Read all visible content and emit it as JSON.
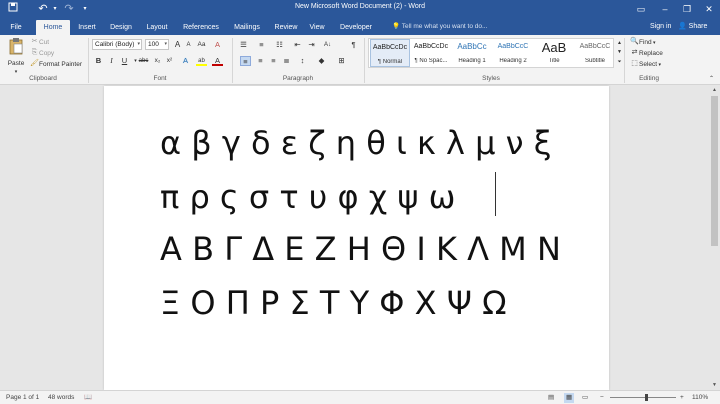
{
  "titlebar": {
    "title": "New Microsoft Word Document (2) - Word",
    "window_buttons": [
      "–",
      "❐",
      "✕"
    ]
  },
  "tabs": [
    "File",
    "Home",
    "Insert",
    "Design",
    "Layout",
    "References",
    "Mailings",
    "Review",
    "View",
    "Developer"
  ],
  "active_tab": "Home",
  "tell_me": "Tell me what you want to do...",
  "sign_in": "Sign in",
  "share": "Share",
  "clipboard": {
    "paste": "Paste",
    "cut": "Cut",
    "copy": "Copy",
    "format_painter": "Format Painter",
    "label": "Clipboard"
  },
  "font": {
    "family": "Calibri (Body)",
    "size": "100",
    "label": "Font",
    "bold": "B",
    "italic": "I",
    "underline": "U",
    "strike": "abc",
    "subscript": "x₂",
    "superscript": "x²",
    "grow": "A",
    "shrink": "A",
    "case": "Aa",
    "clear": "A",
    "effects": "A",
    "highlight": "ab",
    "color": "A"
  },
  "paragraph": {
    "label": "Paragraph",
    "sort": "A↓",
    "show_marks": "¶"
  },
  "styles": {
    "label": "Styles",
    "items": [
      {
        "preview": "AaBbCcDc",
        "name": "¶ Normal"
      },
      {
        "preview": "AaBbCcDc",
        "name": "¶ No Spac..."
      },
      {
        "preview": "AaBbCc",
        "name": "Heading 1"
      },
      {
        "preview": "AaBbCcC",
        "name": "Heading 2"
      },
      {
        "preview": "AaB",
        "name": "Title"
      },
      {
        "preview": "AaBbCcC",
        "name": "Subtitle"
      }
    ]
  },
  "editing": {
    "label": "Editing",
    "find": "Find",
    "replace": "Replace",
    "select": "Select"
  },
  "document": {
    "lines": [
      "α β γ δ ε ζ η θ ι κ λ μ ν ξ",
      "π ρ ς σ τ υ φ χ ψ ω",
      "Α Β Γ Δ Ε Ζ Η Θ Ι Κ Λ Μ Ν",
      "Ξ Ο Π Ρ Σ Τ Υ Φ Χ Ψ Ω"
    ]
  },
  "status": {
    "page": "Page 1 of 1",
    "words": "48 words",
    "zoom": "110%",
    "zoom_minus": "−",
    "zoom_plus": "+"
  },
  "colors": {
    "word_blue": "#2b579a",
    "ribbon_bg": "#f3f3f3",
    "canvas_bg": "#e6e6e6",
    "highlight_yellow": "#ffff00",
    "font_red": "#c00000"
  }
}
